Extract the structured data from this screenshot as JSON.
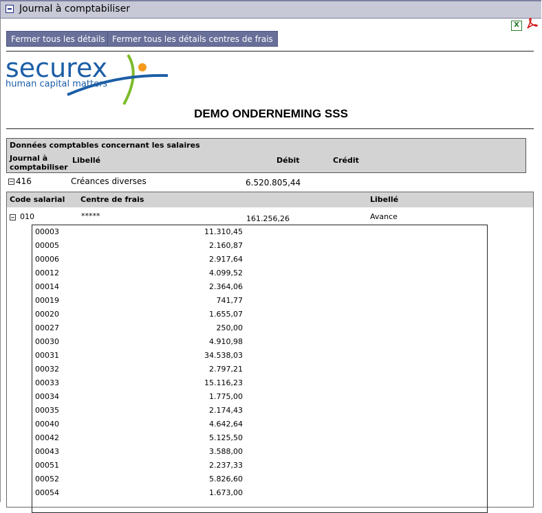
{
  "window": {
    "title": "Journal à comptabiliser"
  },
  "toolbar": {
    "close_details_label": "Fermer tous les détails",
    "close_cost_center_details_label": "Fermer tous les détails centres de frais",
    "excel_icon": "excel-icon",
    "pdf_icon": "pdf-icon"
  },
  "logo": {
    "brand": "securex",
    "tagline": "human capital matters",
    "colors": {
      "blue": "#1c5ea6",
      "orange": "#f59a1b",
      "green": "#7cbb2a"
    }
  },
  "company_name": "DEMO ONDERNEMING SSS",
  "section": {
    "title": "Données comptables concernant les salaires",
    "col_journal_line1": "Journal à",
    "col_journal_line2": "comptabiliser",
    "col_libelle": "Libellé",
    "col_debit": "Débit",
    "col_credit": "Crédit"
  },
  "journal_row": {
    "code": "416",
    "libelle": "Créances diverses",
    "debit": "6.520.805,44"
  },
  "salary_table": {
    "col_code": "Code salarial",
    "col_cost_center": "Centre de frais",
    "col_libelle": "Libellé"
  },
  "salary_row": {
    "code": "010",
    "cost_center": "*****",
    "amount": "161.256,26",
    "libelle": "Avance"
  },
  "details": [
    {
      "code": "00003",
      "value": "11.310,45"
    },
    {
      "code": "00005",
      "value": "2.160,87"
    },
    {
      "code": "00006",
      "value": "2.917,64"
    },
    {
      "code": "00012",
      "value": "4.099,52"
    },
    {
      "code": "00014",
      "value": "2.364,06"
    },
    {
      "code": "00019",
      "value": "741,77"
    },
    {
      "code": "00020",
      "value": "1.655,07"
    },
    {
      "code": "00027",
      "value": "250,00"
    },
    {
      "code": "00030",
      "value": "4.910,98"
    },
    {
      "code": "00031",
      "value": "34.538,03"
    },
    {
      "code": "00032",
      "value": "2.797,21"
    },
    {
      "code": "00033",
      "value": "15.116,23"
    },
    {
      "code": "00034",
      "value": "1.775,00"
    },
    {
      "code": "00035",
      "value": "2.174,43"
    },
    {
      "code": "00040",
      "value": "4.642,64"
    },
    {
      "code": "00042",
      "value": "5.125,50"
    },
    {
      "code": "00043",
      "value": "3.588,00"
    },
    {
      "code": "00051",
      "value": "2.237,33"
    },
    {
      "code": "00052",
      "value": "5.826,60"
    },
    {
      "code": "00054",
      "value": "1.673,00"
    }
  ]
}
